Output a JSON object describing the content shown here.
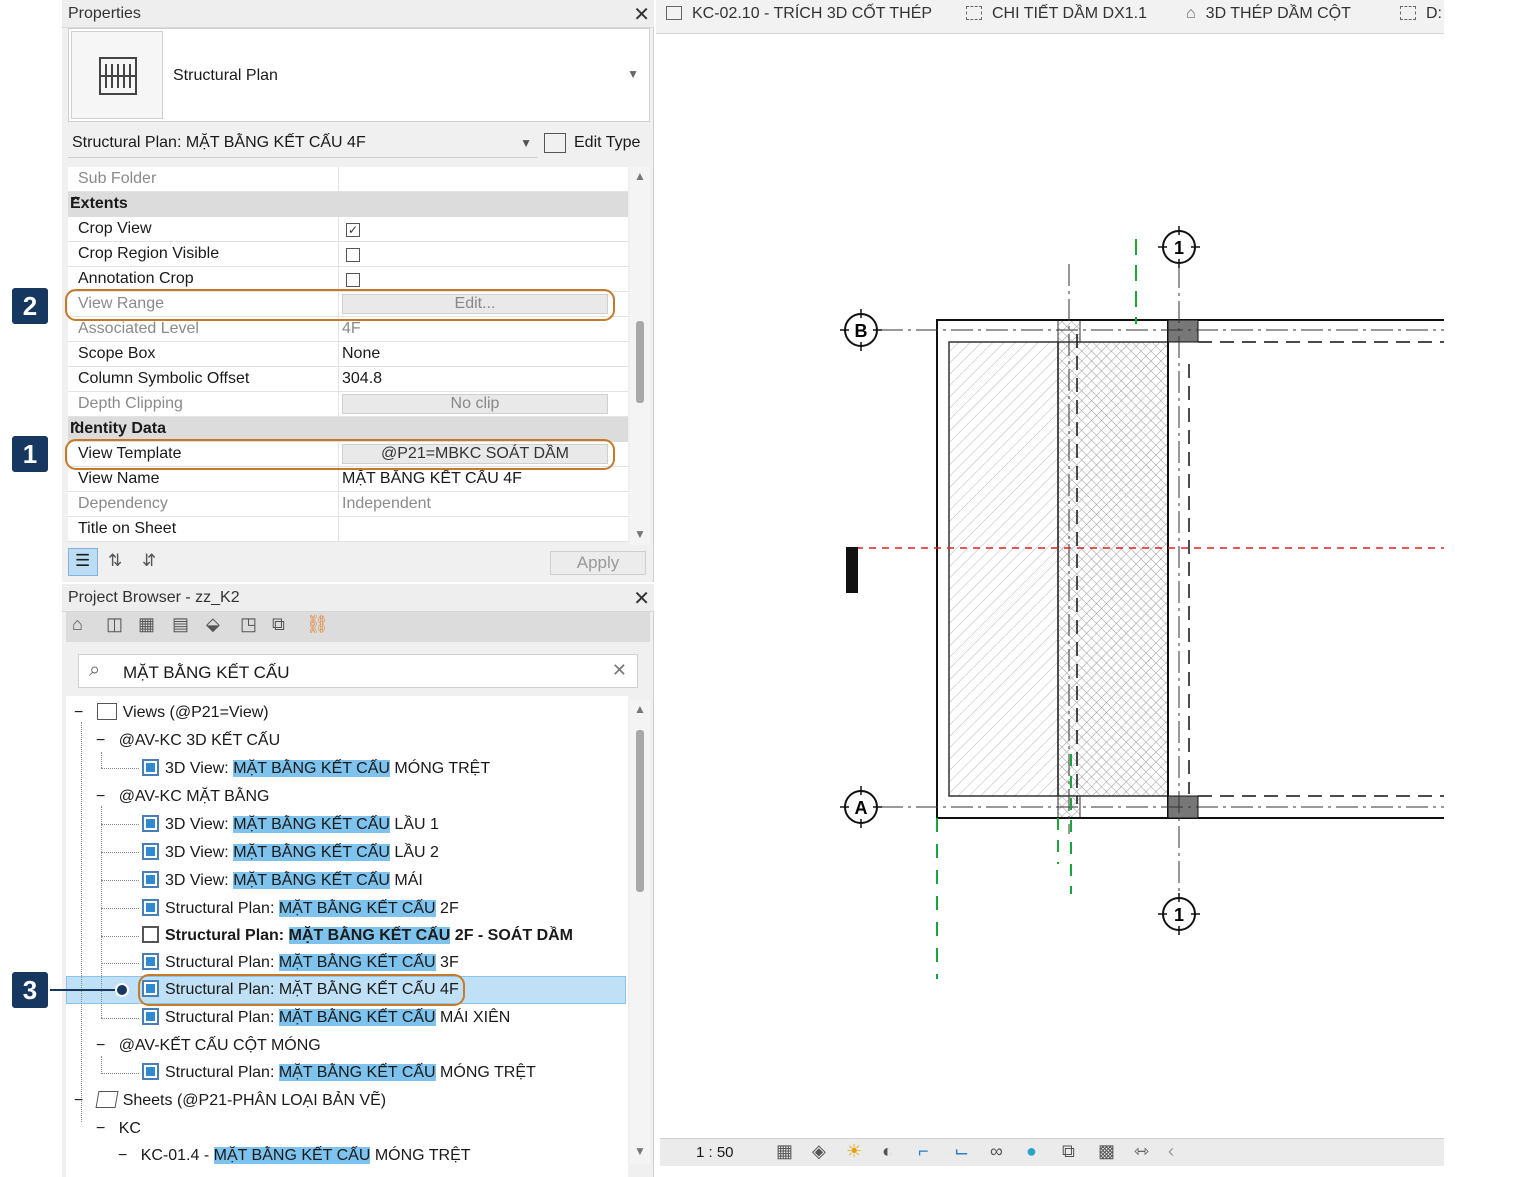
{
  "properties": {
    "title": "Properties",
    "type_name": "Structural Plan",
    "selector": "Structural Plan: MẶT BẰNG KẾT CẤU 4F",
    "edit_type": "Edit Type",
    "rows": {
      "sub_folder": "Sub Folder",
      "extents_group": "Extents",
      "crop_view": "Crop View",
      "crop_region_visible": "Crop Region Visible",
      "annotation_crop": "Annotation Crop",
      "view_range": "View Range",
      "view_range_value": "Edit...",
      "associated_level": "Associated Level",
      "associated_level_value": "4F",
      "scope_box": "Scope Box",
      "scope_box_value": "None",
      "column_offset": "Column Symbolic Offset",
      "column_offset_value": "304.8",
      "depth_clipping": "Depth Clipping",
      "depth_clipping_value": "No clip",
      "identity_group": "Identity Data",
      "view_template": "View Template",
      "view_template_value": "@P21=MBKC SOÁT DẦM",
      "view_name": "View Name",
      "view_name_value": "MẶT BẰNG KẾT CẤU 4F",
      "dependency": "Dependency",
      "dependency_value": "Independent",
      "title_on_sheet": "Title on Sheet"
    },
    "apply": "Apply"
  },
  "badges": {
    "one": "1",
    "two": "2",
    "three": "3"
  },
  "browser": {
    "title": "Project Browser - zz_K2",
    "search": "MẶT BẰNG KẾT CẤU",
    "items": [
      {
        "prefix": "Views (@P21=View)",
        "hl": "",
        "suffix": ""
      },
      {
        "prefix": "@AV-KC 3D KẾT CẤU",
        "hl": "",
        "suffix": ""
      },
      {
        "prefix": "3D View: ",
        "hl": "MẶT BẰNG KẾT CẤU",
        "suffix": " MÓNG TRỆT"
      },
      {
        "prefix": "@AV-KC MẶT BẰNG",
        "hl": "",
        "suffix": ""
      },
      {
        "prefix": "3D View: ",
        "hl": "MẶT BẰNG KẾT CẤU",
        "suffix": " LẦU 1"
      },
      {
        "prefix": "3D View: ",
        "hl": "MẶT BẰNG KẾT CẤU",
        "suffix": " LẦU 2"
      },
      {
        "prefix": "3D View: ",
        "hl": "MẶT BẰNG KẾT CẤU",
        "suffix": " MÁI"
      },
      {
        "prefix": "Structural Plan: ",
        "hl": "MẶT BẰNG KẾT CẤU",
        "suffix": " 2F"
      },
      {
        "prefix": "Structural Plan: ",
        "hl": "MẶT BẰNG KẾT CẤU",
        "suffix": " 2F - SOÁT DẦM"
      },
      {
        "prefix": "Structural Plan: ",
        "hl": "MẶT BẰNG KẾT CẤU",
        "suffix": " 3F"
      },
      {
        "prefix": "Structural Plan: MẶT BẰNG KẾT CẤU 4F",
        "hl": "",
        "suffix": ""
      },
      {
        "prefix": "Structural Plan: ",
        "hl": "MẶT BẰNG KẾT CẤU",
        "suffix": " MÁI XIÊN"
      },
      {
        "prefix": "@AV-KẾT CẤU CỘT MÓNG",
        "hl": "",
        "suffix": ""
      },
      {
        "prefix": "Structural Plan: ",
        "hl": "MẶT BẰNG KẾT CẤU",
        "suffix": " MÓNG TRỆT"
      },
      {
        "prefix": "Sheets (@P21-PHÂN LOẠI BẢN VẼ)",
        "hl": "",
        "suffix": ""
      },
      {
        "prefix": "KC",
        "hl": "",
        "suffix": ""
      },
      {
        "prefix": "KC-01.4 - ",
        "hl": "MẶT BẰNG KẾT CẤU",
        "suffix": " MÓNG TRỆT"
      }
    ]
  },
  "tabs": [
    "KC-02.10 - TRÍCH 3D CỐT THÉP",
    "CHI TIẾT DẦM DX1.1",
    "3D THÉP DẦM CỘT",
    "D:"
  ],
  "drawing": {
    "grid_b": "B",
    "grid_a": "A",
    "grid_1": "1",
    "scale": "1 : 50"
  }
}
